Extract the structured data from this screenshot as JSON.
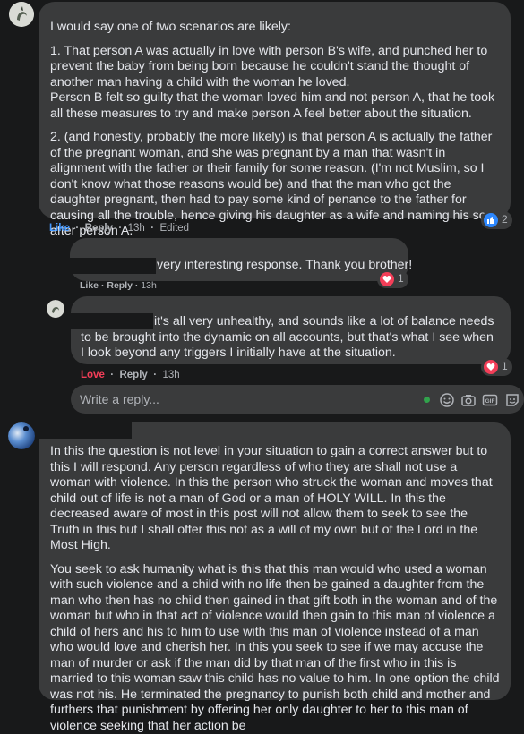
{
  "comment1": {
    "paragraphs": [
      "I would say one of two scenarios are likely:",
      "1. That person A was actually in love with person B's wife, and punched her to prevent the baby from being born because he couldn't stand the thought of another man having a child with the woman he loved.\nPerson B felt so guilty that the woman loved him and not person A, that he took all these measures to try and make person A feel better about the situation.",
      "2. (and honestly, probably the more likely) is that person A is actually the father of the pregnant woman, and she was pregnant by a man that wasn't in alignment with the father or their family for some reason. (I'm not Muslim, so I don't know what those reasons would be) and that the man who got the daughter pregnant, then had to pay some kind of penance to the father for causing all the trouble, hence giving his daughter as a wife and naming his son after person A."
    ],
    "like": "Like",
    "reply": "Reply",
    "time": "13h",
    "edited": "Edited",
    "reaction_count": "2",
    "reaction_color": "#2d88ff"
  },
  "reply1": {
    "text": "very interesting response. Thank you brother!",
    "like": "Like",
    "reply": "Reply",
    "time": "13h",
    "reaction_count": "1",
    "reaction_color": "#f33e58"
  },
  "reply2": {
    "text": "it's all very unhealthy, and sounds like a lot of balance needs to be brought into the dynamic on all accounts, but that's what I see when I look beyond any triggers I initially have at the situation.",
    "like": "Love",
    "reply": "Reply",
    "time": "13h",
    "reaction_count": "1",
    "reaction_color": "#f33e58",
    "love_color": "#f33e58"
  },
  "reply_input": {
    "placeholder": "Write a reply...",
    "icons": [
      "emoji-icon",
      "camera-icon",
      "gif-icon",
      "sticker-icon"
    ]
  },
  "comment2": {
    "paragraphs": [
      "In this the question is not level in your situation to gain a correct answer but to this I will respond. Any person regardless of who they are shall not use a woman with violence. In this the person who struck the woman and moves that child out of life is not a man of God or a man of HOLY WILL. In this the decreased aware of most in this post will not allow them to seek to see the Truth in this but I shall offer this not as a will of my own but of the Lord in the Most High.",
      "You seek to ask humanity what is this that this man would who used a woman with such violence and a child with no life then be gained a daughter from the man who then has no child then gained in that gift both in the woman and of the woman but who in that act of violence would then gain to this man of violence a child of hers and his to him to use with this man of violence instead of a man who would love and cherish her. In this you seek to see if we may accuse the man of murder or ask if the man did by that man of the first who in this is married to this woman saw this child has no value to him. In one option the child was not his. He terminated the pregnancy to punish both child and mother and furthers that punishment by offering her only daughter to her to this man of violence seeking that her action be"
    ]
  }
}
